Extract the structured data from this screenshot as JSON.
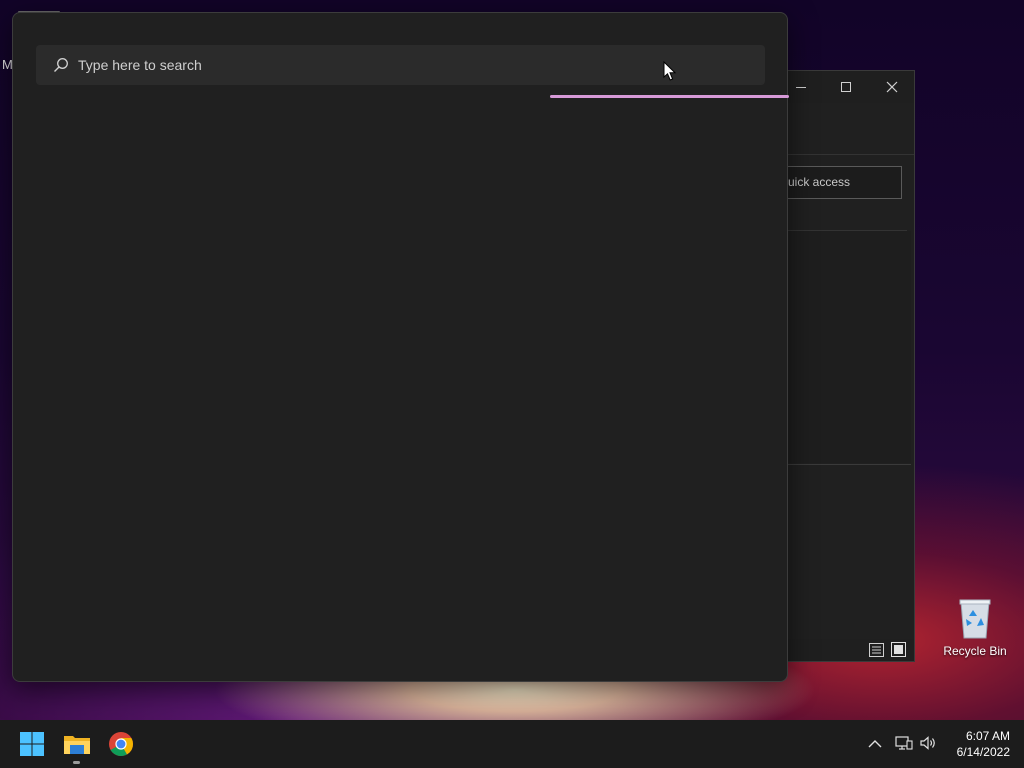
{
  "desktop": {
    "edge_text": "M",
    "recycle_bin_label": "Recycle Bin"
  },
  "search": {
    "placeholder": "Type here to search",
    "value": ""
  },
  "explorer_window": {
    "address_text": "uick access",
    "buttons": {
      "minimize": "minimize-icon",
      "maximize": "maximize-icon",
      "close": "close-icon"
    }
  },
  "taskbar": {
    "apps": [
      "start-icon",
      "file-explorer-icon",
      "chrome-icon"
    ],
    "tray": [
      "chevron-up-icon",
      "network-icon",
      "volume-icon"
    ],
    "time": "6:07 AM",
    "date": "6/14/2022"
  },
  "colors": {
    "panel_bg": "#202020",
    "search_box_bg": "#2b2b2b",
    "loading_accent": "#d79ad8",
    "taskbar_bg": "#1c1c1c",
    "start_blue": "#4cc2ff"
  }
}
